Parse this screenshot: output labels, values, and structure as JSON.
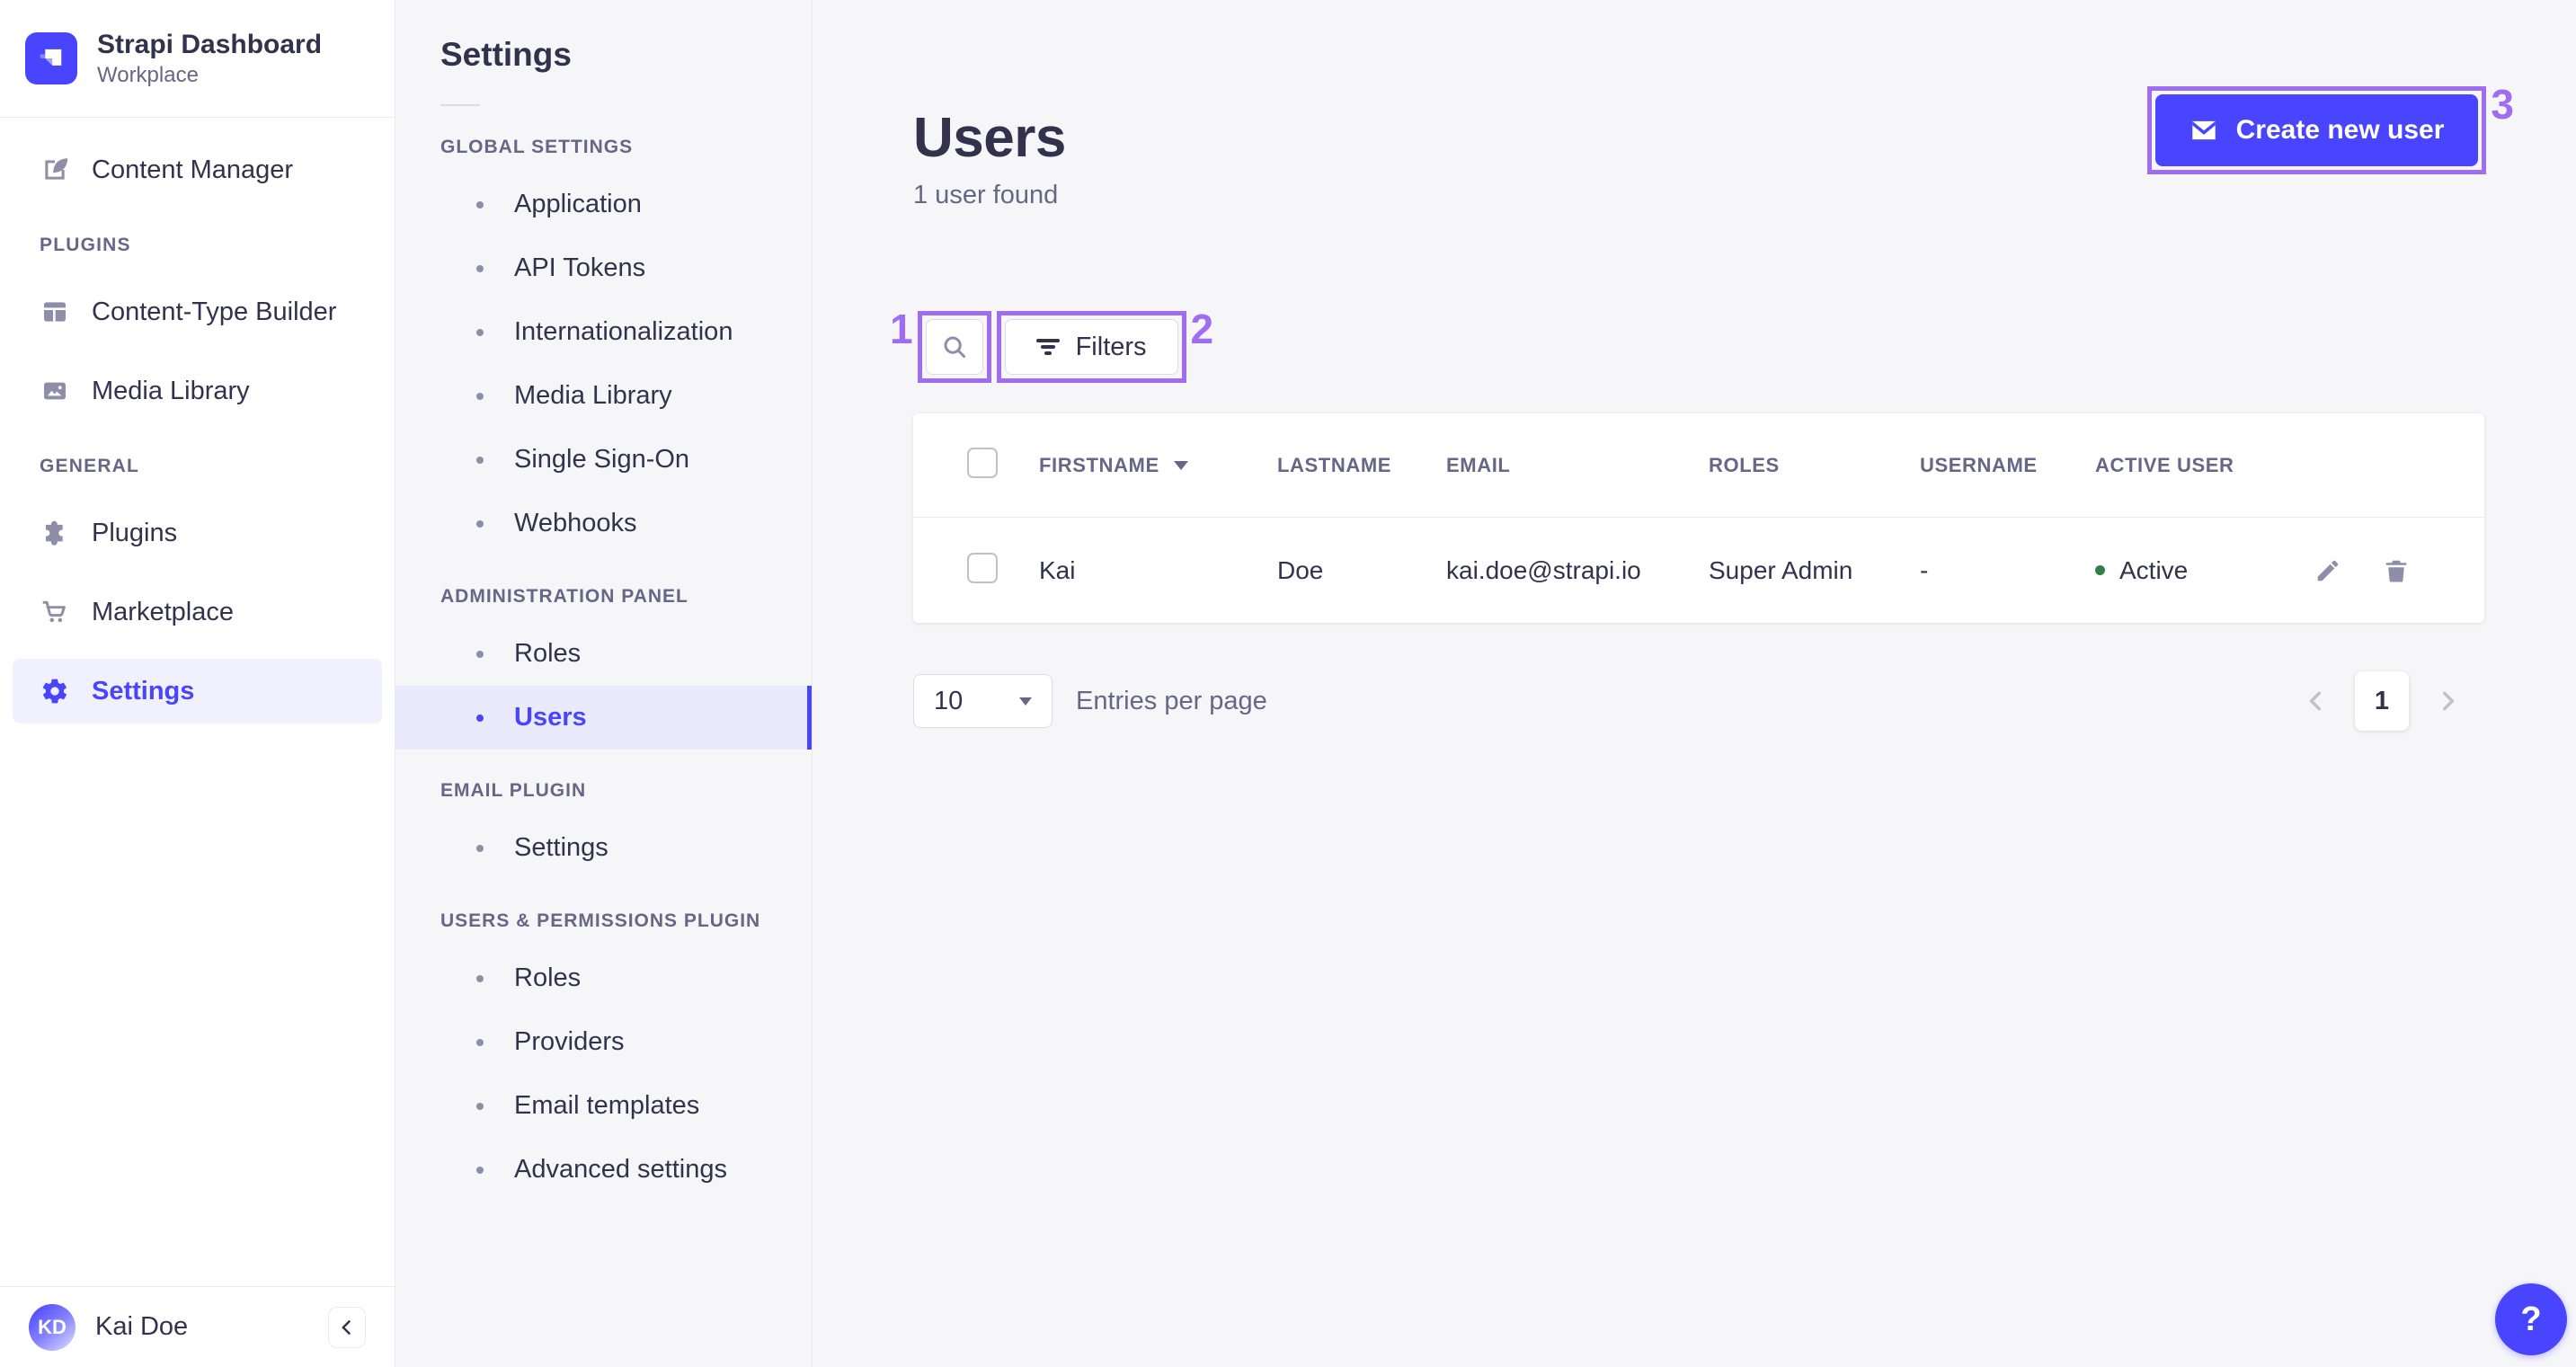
{
  "colors": {
    "primary": "#4945ff",
    "primary_light_bg": "#f0f0ff",
    "subnav_active_bg": "#eaeafd",
    "annotation": "#9e6df2",
    "success": "#328048",
    "text_dark": "#32324d",
    "text_muted": "#666687",
    "icon_muted": "#8e8ea9",
    "border": "#eaeaef"
  },
  "sidebar": {
    "brand": {
      "title": "Strapi Dashboard",
      "subtitle": "Workplace",
      "logo_icon": "strapi-mark"
    },
    "sections": [
      {
        "label": "PLUGINS"
      },
      {
        "label": "GENERAL"
      }
    ],
    "items": [
      {
        "label": "Content Manager",
        "icon": "feather-pen"
      },
      {
        "label": "Content-Type Builder",
        "icon": "layout-grid"
      },
      {
        "label": "Media Library",
        "icon": "picture"
      },
      {
        "label": "Plugins",
        "icon": "puzzle-piece"
      },
      {
        "label": "Marketplace",
        "icon": "shopping-cart"
      },
      {
        "label": "Settings",
        "icon": "gear"
      }
    ],
    "user": {
      "initials": "KD",
      "name": "Kai Doe"
    },
    "collapse_icon": "chevron-left"
  },
  "subnav": {
    "title": "Settings",
    "sections": [
      {
        "label": "GLOBAL SETTINGS",
        "items": [
          {
            "label": "Application"
          },
          {
            "label": "API Tokens"
          },
          {
            "label": "Internationalization"
          },
          {
            "label": "Media Library"
          },
          {
            "label": "Single Sign-On"
          },
          {
            "label": "Webhooks"
          }
        ]
      },
      {
        "label": "ADMINISTRATION PANEL",
        "items": [
          {
            "label": "Roles"
          },
          {
            "label": "Users"
          }
        ]
      },
      {
        "label": "EMAIL PLUGIN",
        "items": [
          {
            "label": "Settings"
          }
        ]
      },
      {
        "label": "USERS & PERMISSIONS PLUGIN",
        "items": [
          {
            "label": "Roles"
          },
          {
            "label": "Providers"
          },
          {
            "label": "Email templates"
          },
          {
            "label": "Advanced settings"
          }
        ]
      }
    ]
  },
  "main": {
    "title": "Users",
    "subtitle": "1 user found",
    "create_button": {
      "label": "Create new user",
      "icon": "envelope"
    },
    "filters_button": {
      "label": "Filters",
      "icon": "filter-bars"
    },
    "search_button": {
      "icon": "magnifier"
    },
    "annotations": {
      "search": "1",
      "filters": "2",
      "create": "3"
    },
    "table": {
      "headers": [
        "FIRSTNAME",
        "LASTNAME",
        "EMAIL",
        "ROLES",
        "USERNAME",
        "ACTIVE USER"
      ],
      "rows": [
        {
          "firstname": "Kai",
          "lastname": "Doe",
          "email": "kai.doe@strapi.io",
          "roles": "Super Admin",
          "username": "-",
          "active_label": "Active"
        }
      ],
      "row_actions": [
        "edit-pencil",
        "trash"
      ]
    },
    "pagination": {
      "page_size": "10",
      "entries_label": "Entries per page",
      "page": "1",
      "prev_icon": "chevron-left",
      "next_icon": "chevron-right"
    }
  },
  "help": {
    "label": "?"
  }
}
